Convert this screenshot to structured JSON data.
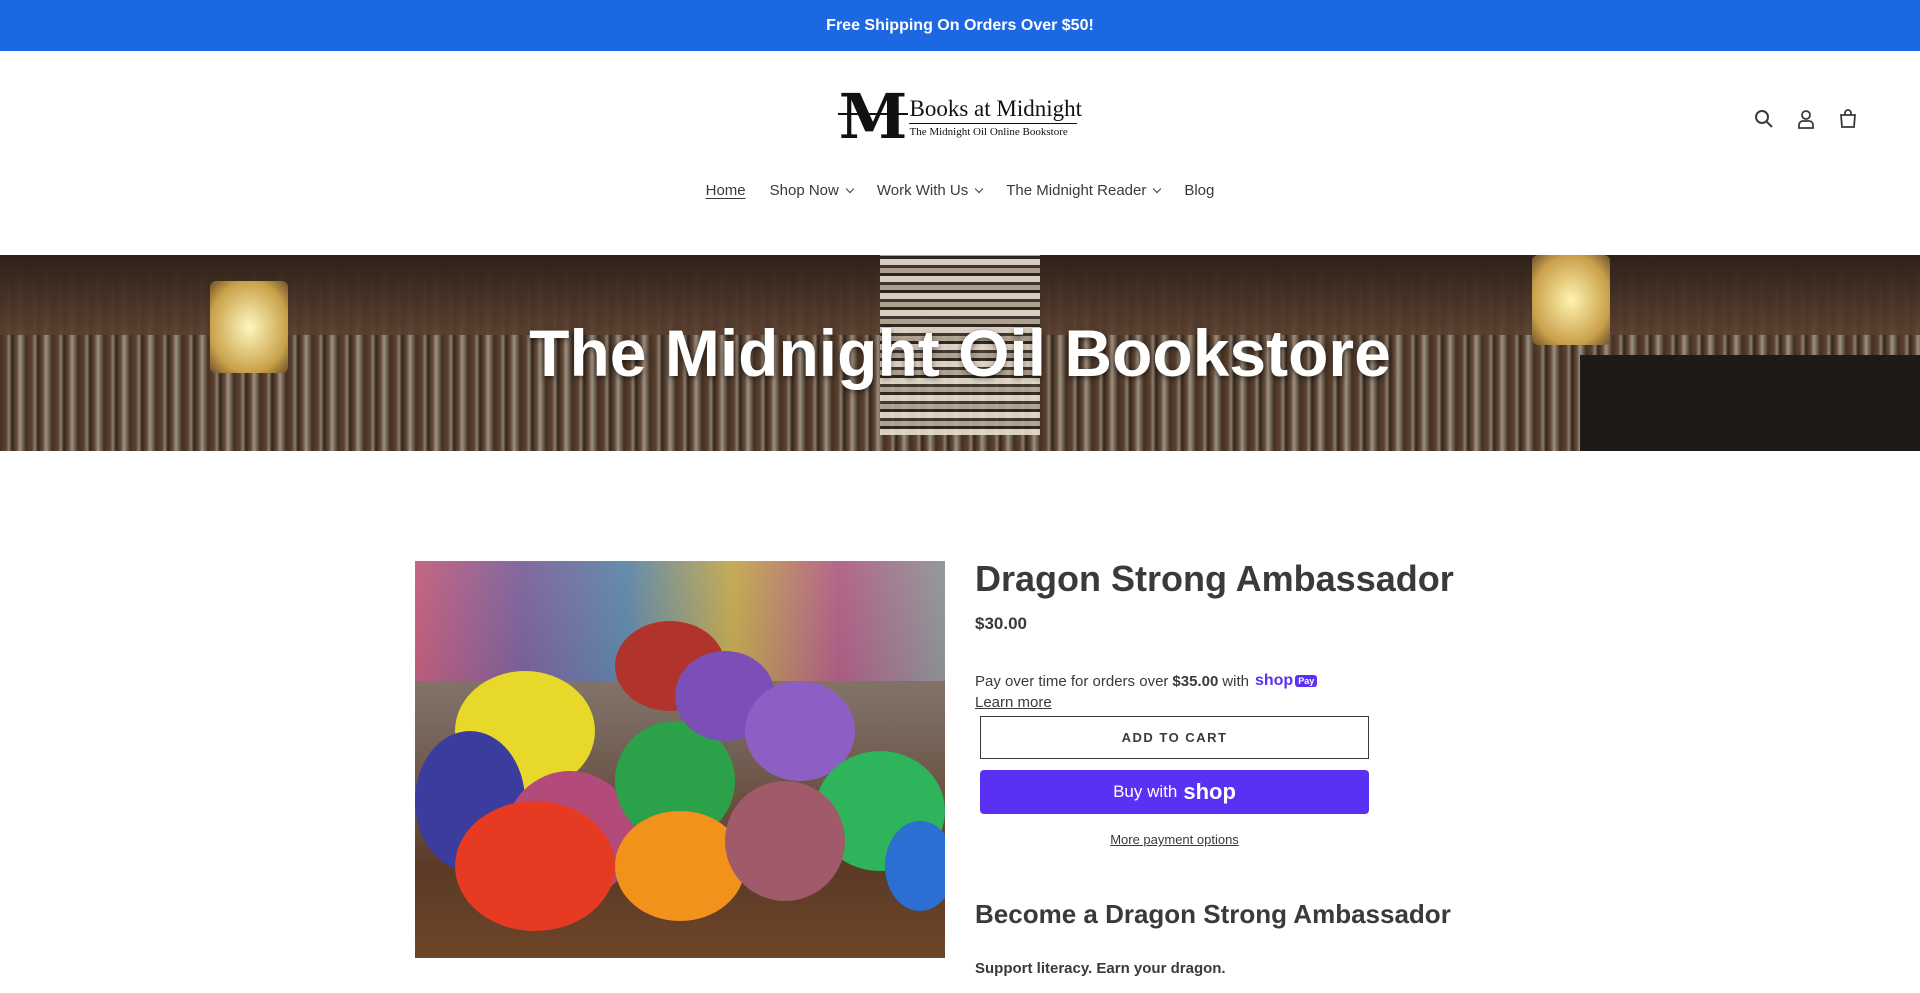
{
  "announcement": {
    "text": "Free Shipping On Orders Over $50!",
    "bg_color": "#1c68e3"
  },
  "logo": {
    "title": "Books at Midnight",
    "subtitle": "The Midnight Oil Online Bookstore",
    "letter": "M"
  },
  "header": {
    "icons": [
      "search-icon",
      "account-icon",
      "cart-icon"
    ]
  },
  "nav": {
    "items": [
      {
        "label": "Home",
        "active": true,
        "dropdown": false
      },
      {
        "label": "Shop Now",
        "active": false,
        "dropdown": true
      },
      {
        "label": "Work With Us",
        "active": false,
        "dropdown": true
      },
      {
        "label": "The Midnight Reader",
        "active": false,
        "dropdown": true
      },
      {
        "label": "Blog",
        "active": false,
        "dropdown": false
      }
    ]
  },
  "hero": {
    "title": "The Midnight Oil Bookstore"
  },
  "product": {
    "title": "Dragon Strong Ambassador",
    "price": "$30.00",
    "installments": {
      "prefix": "Pay over time for orders over",
      "amount": "$35.00",
      "suffix": "with",
      "brand": "shop",
      "badge": "Pay"
    },
    "learn_more": "Learn more",
    "add_to_cart": "ADD TO CART",
    "buy_with": "Buy with",
    "buy_brand": "shop",
    "more_payment": "More payment options",
    "accent_color": "#5a31f4"
  },
  "description": {
    "heading": "Become a Dragon Strong Ambassador",
    "tagline": "Support literacy. Earn your dragon."
  }
}
